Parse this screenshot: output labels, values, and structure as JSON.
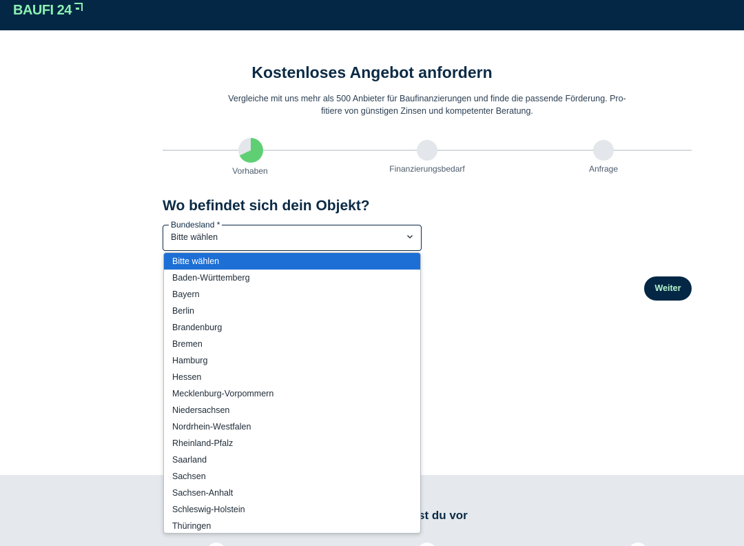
{
  "header": {
    "logo_text": "BAUFI 24"
  },
  "page": {
    "title": "Kostenloses Angebot anfordern",
    "subtitle_line1": "Vergleiche mit uns mehr als 500 Anbieter für Baufinanzierungen und finde die passende Förderung. Pro-",
    "subtitle_line2": "fitiere von günstigen Zinsen und kompetenter Beratung."
  },
  "steps": [
    {
      "label": "Vorhaben",
      "state": "active",
      "progress": 0.68
    },
    {
      "label": "Finanzierungsbedarf",
      "state": "pending"
    },
    {
      "label": "Anfrage",
      "state": "pending"
    }
  ],
  "form": {
    "question": "Wo befindet sich dein Objekt?",
    "select_label": "Bundesland *",
    "select_value": "Bitte wählen",
    "options": [
      "Bitte wählen",
      "Baden-Württemberg",
      "Bayern",
      "Berlin",
      "Brandenburg",
      "Bremen",
      "Hamburg",
      "Hessen",
      "Mecklenburg-Vorpommern",
      "Niedersachsen",
      "Nordrhein-Westfalen",
      "Rheinland-Pfalz",
      "Saarland",
      "Sachsen",
      "Sachsen-Anhalt",
      "Schleswig-Holstein",
      "Thüringen"
    ],
    "next_button": "Weiter"
  },
  "bottom": {
    "heading_partial": "st du vor"
  },
  "colors": {
    "header_bg": "#032744",
    "brand_green": "#8cf0b2",
    "progress_green": "#5fcf73",
    "option_highlight": "#1d6fd6",
    "bottom_band": "#e5e9ed"
  }
}
